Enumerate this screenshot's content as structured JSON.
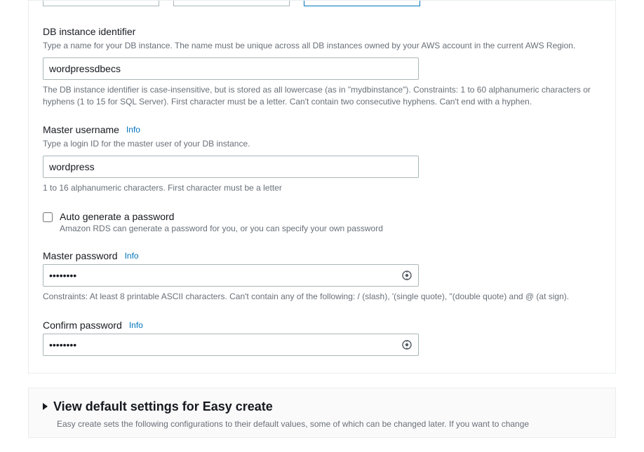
{
  "dbIdentifier": {
    "label": "DB instance identifier",
    "desc": "Type a name for your DB instance. The name must be unique across all DB instances owned by your AWS account in the current AWS Region.",
    "value": "wordpressdbecs",
    "hint": "The DB instance identifier is case-insensitive, but is stored as all lowercase (as in \"mydbinstance\"). Constraints: 1 to 60 alphanumeric characters or hyphens (1 to 15 for SQL Server). First character must be a letter. Can't contain two consecutive hyphens. Can't end with a hyphen."
  },
  "masterUsername": {
    "label": "Master username",
    "info": "Info",
    "desc": "Type a login ID for the master user of your DB instance.",
    "value": "wordpress",
    "hint": "1 to 16 alphanumeric characters. First character must be a letter"
  },
  "autoGenerate": {
    "label": "Auto generate a password",
    "desc": "Amazon RDS can generate a password for you, or you can specify your own password"
  },
  "masterPassword": {
    "label": "Master password",
    "info": "Info",
    "value": "••••••••",
    "hint": "Constraints: At least 8 printable ASCII characters. Can't contain any of the following: / (slash), '(single quote), \"(double quote) and @ (at sign)."
  },
  "confirmPassword": {
    "label": "Confirm password",
    "info": "Info",
    "value": "••••••••"
  },
  "defaultSettings": {
    "title": "View default settings for Easy create",
    "desc": "Easy create sets the following configurations to their default values, some of which can be changed later. If you want to change"
  }
}
